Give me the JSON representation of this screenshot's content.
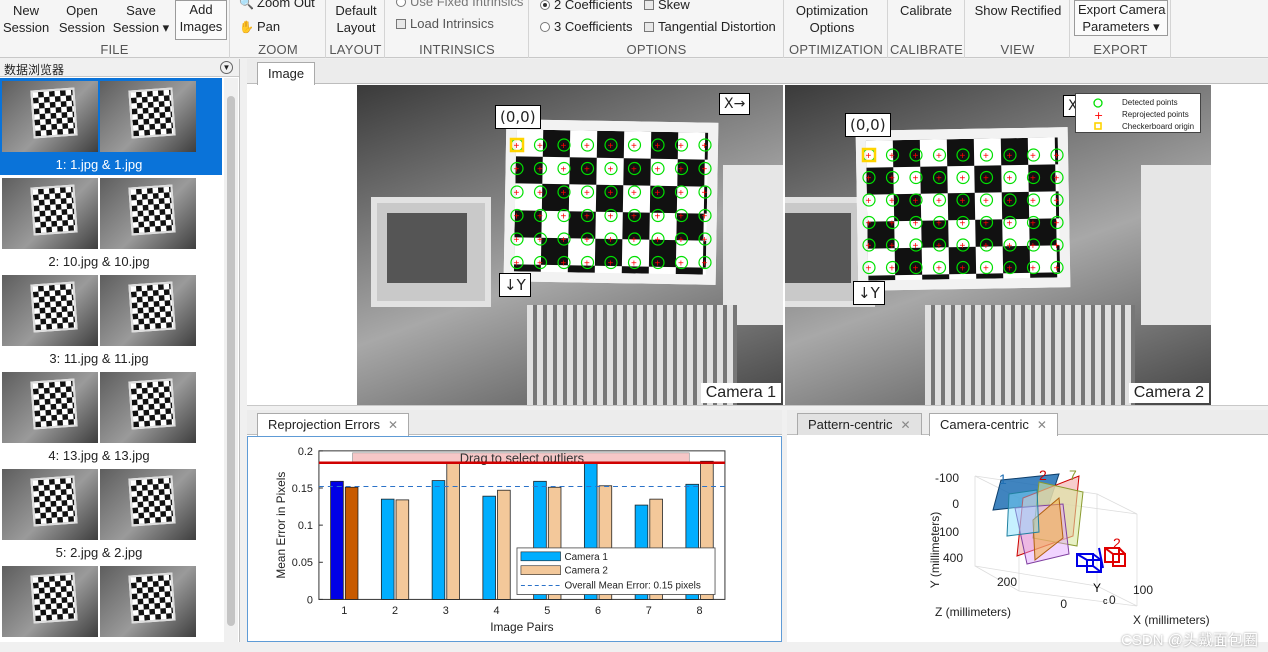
{
  "toolstrip": {
    "file": {
      "label": "FILE",
      "new": "New\nSession",
      "open": "Open\nSession",
      "save": "Save\nSession ▾",
      "add": "Add\nImages"
    },
    "zoom": {
      "label": "ZOOM",
      "zoom_out": "Zoom Out",
      "pan": "Pan"
    },
    "layout": {
      "label": "LAYOUT",
      "default": "Default\nLayout"
    },
    "intrinsics": {
      "label": "INTRINSICS",
      "use_fixed": "Use Fixed Intrinsics",
      "load": "Load Intrinsics"
    },
    "options": {
      "label": "OPTIONS",
      "coef2": "2 Coefficients",
      "coef3": "3 Coefficients",
      "skew": "Skew",
      "tangential": "Tangential Distortion"
    },
    "optimization": {
      "label": "OPTIMIZATION",
      "options": "Optimization\nOptions"
    },
    "calibrate": {
      "label": "CALIBRATE",
      "calibrate": "Calibrate"
    },
    "view": {
      "label": "VIEW",
      "show_rectified": "Show Rectified"
    },
    "export": {
      "label": "EXPORT",
      "export_params": "Export Camera\nParameters ▾"
    }
  },
  "browser": {
    "title": "数据浏览器",
    "pairs": [
      {
        "caption": "1: 1.jpg & 1.jpg",
        "selected": true
      },
      {
        "caption": "2: 10.jpg & 10.jpg",
        "selected": false
      },
      {
        "caption": "3: 11.jpg & 11.jpg",
        "selected": false
      },
      {
        "caption": "4: 13.jpg & 13.jpg",
        "selected": false
      },
      {
        "caption": "5: 2.jpg & 2.jpg",
        "selected": false
      },
      {
        "caption": "",
        "selected": false
      }
    ]
  },
  "image_panel": {
    "tab": "Image",
    "origin_label": "(0,0)",
    "x_label": "X→",
    "y_label": "↓Y",
    "camera1": "Camera 1",
    "camera2": "Camera 2",
    "legend": {
      "detected": "Detected points",
      "reprojected": "Reprojected points",
      "origin": "Checkerboard origin"
    },
    "colors": {
      "detected": "#00e000",
      "reprojected": "#ff0000",
      "origin": "#ffd400"
    }
  },
  "reprojection": {
    "tab": "Reprojection Errors",
    "close": "✕",
    "drag_text": "Drag to select outliers"
  },
  "extrinsics": {
    "tab_pattern": "Pattern-centric",
    "tab_camera": "Camera-centric",
    "close": "✕",
    "ylabel": "Y (millimeters)",
    "zlabel": "Z (millimeters)",
    "xlabel": "X (millimeters)",
    "y_ticks": [
      "-100",
      "0",
      "100"
    ],
    "z_ticks": [
      "400",
      "200",
      "0"
    ],
    "x_ticks": [
      "0",
      "100"
    ],
    "pattern_labels": [
      "1",
      "2",
      "7",
      "2"
    ],
    "camera_label": "Y",
    "camera_sub": "c"
  },
  "chart_data": {
    "type": "bar",
    "title": "",
    "xlabel": "Image Pairs",
    "ylabel": "Mean Error in Pixels",
    "categories": [
      "1",
      "2",
      "3",
      "4",
      "5",
      "6",
      "7",
      "8"
    ],
    "ylim": [
      0,
      0.2
    ],
    "yticks": [
      0,
      0.05,
      0.1,
      0.15,
      0.2
    ],
    "series": [
      {
        "name": "Camera 1",
        "color": "#00aeff",
        "values": [
          0.159,
          0.135,
          0.16,
          0.139,
          0.159,
          0.183,
          0.127,
          0.155
        ]
      },
      {
        "name": "Camera 2",
        "color": "#f3c89a",
        "values": [
          0.151,
          0.134,
          0.183,
          0.147,
          0.151,
          0.153,
          0.135,
          0.186
        ]
      }
    ],
    "selected_colors": {
      "camera1": "#0000e6",
      "camera2": "#c85a00"
    },
    "selected_index": 0,
    "overall_mean_label": "Overall Mean Error: 0.15 pixels",
    "overall_mean": 0.152,
    "outlier_threshold": 0.184,
    "legend_position": "bottom-right",
    "grid": false
  },
  "watermark": "CSDN @头戴面包圈"
}
